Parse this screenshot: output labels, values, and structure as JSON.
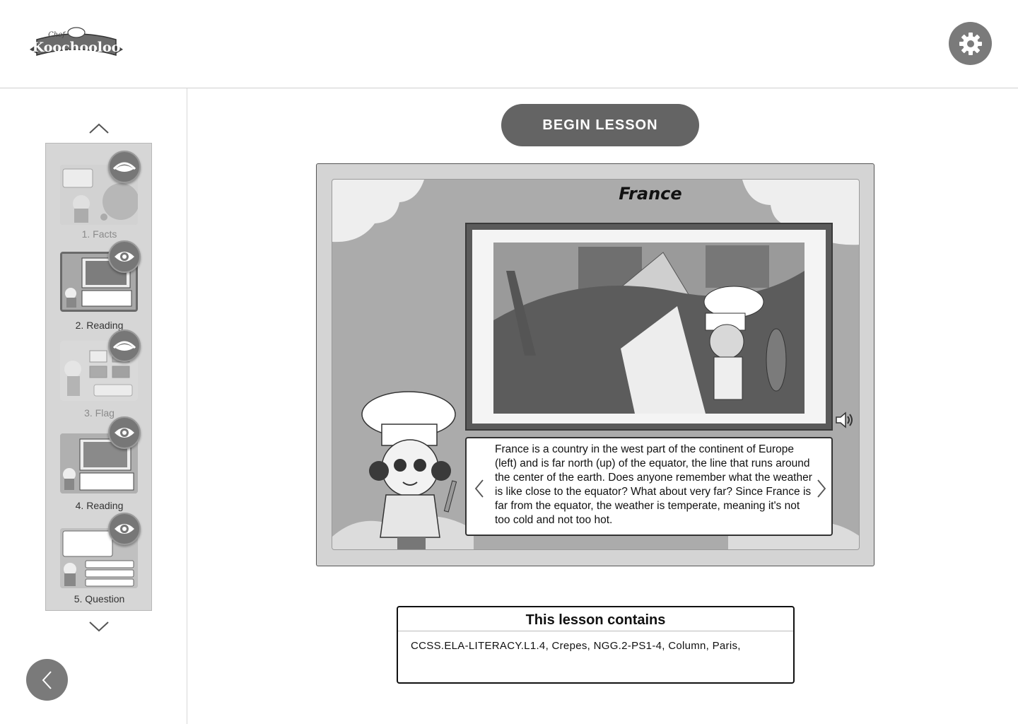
{
  "app": {
    "logo_brand": "Koochooloo",
    "logo_tag": "Chef"
  },
  "header": {
    "settings_icon": "gear-icon"
  },
  "sidebar": {
    "slides": [
      {
        "label": "1. Facts",
        "state": "faded",
        "badge": "eye-closed-icon"
      },
      {
        "label": "2. Reading",
        "state": "active",
        "badge": "eye-open-icon"
      },
      {
        "label": "3. Flag",
        "state": "faded",
        "badge": "eye-closed-icon"
      },
      {
        "label": "4. Reading",
        "state": "normal",
        "badge": "eye-open-icon"
      },
      {
        "label": "5. Question",
        "state": "normal",
        "badge": "eye-open-icon"
      }
    ],
    "back_icon": "chevron-left-icon"
  },
  "main": {
    "begin_label": "BEGIN LESSON",
    "slide": {
      "title": "France",
      "body": "France is a country in the west part of the continent of Europe (left) and is far north (up) of the equator, the line that runs around the center of the earth. Does anyone remember what the weather is like close to the equator? What about very far? Since France is far from the equator, the weather is temperate, meaning it's not too cold and not too hot."
    },
    "contains": {
      "title": "This lesson contains",
      "items": "CCSS.ELA-LITERACY.L1.4, Crepes, NGG.2-PS1-4, Column, Paris,"
    }
  },
  "colors": {
    "button_gray": "#646464",
    "icon_gray": "#7a7a7a",
    "frame_gray": "#d4d4d4"
  }
}
